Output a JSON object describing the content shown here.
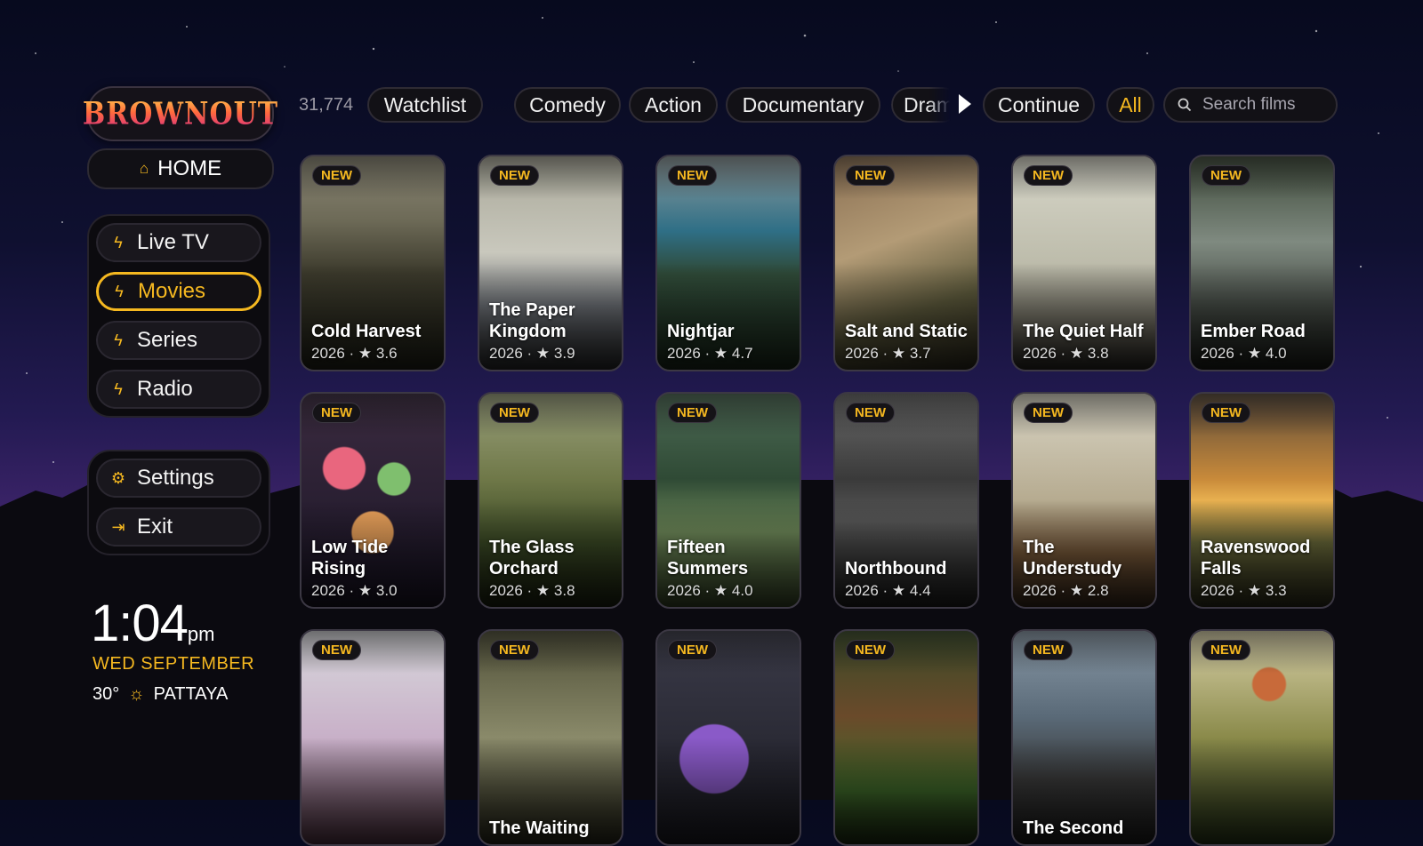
{
  "app": {
    "logo_text": "BROWNOUT"
  },
  "sidebar": {
    "home_label": "HOME",
    "home_icon": "home-icon",
    "nav": [
      {
        "label": "Live TV",
        "icon": "bolt-icon"
      },
      {
        "label": "Movies",
        "icon": "bolt-icon",
        "active": true
      },
      {
        "label": "Series",
        "icon": "bolt-icon"
      },
      {
        "label": "Radio",
        "icon": "bolt-icon"
      }
    ],
    "system": [
      {
        "label": "Settings",
        "icon": "gear-icon"
      },
      {
        "label": "Exit",
        "icon": "exit-icon"
      }
    ]
  },
  "clock": {
    "time": "1:04",
    "ampm": "pm",
    "date": "WED SEPTEMBER",
    "temperature": "30°",
    "city": "PATTAYA",
    "weather_icon": "sun-icon"
  },
  "topbar": {
    "count": "31,774",
    "watchlist": "Watchlist",
    "genres": [
      "Comedy",
      "Action",
      "Documentary",
      "Drama"
    ],
    "continue": "Continue",
    "all": "All",
    "search_placeholder": "Search films"
  },
  "accent_color": "#f5b820",
  "movies": [
    {
      "title": "Cold Harvest",
      "year": "2026",
      "rating": "3.6",
      "badge": "NEW"
    },
    {
      "title": "The Paper Kingdom",
      "year": "2026",
      "rating": "3.9",
      "badge": "NEW"
    },
    {
      "title": "Nightjar",
      "year": "2026",
      "rating": "4.7",
      "badge": "NEW"
    },
    {
      "title": "Salt and Static",
      "year": "2026",
      "rating": "3.7",
      "badge": "NEW"
    },
    {
      "title": "The Quiet Half",
      "year": "2026",
      "rating": "3.8",
      "badge": "NEW"
    },
    {
      "title": "Ember Road",
      "year": "2026",
      "rating": "4.0",
      "badge": "NEW"
    },
    {
      "title": "Low Tide Rising",
      "year": "2026",
      "rating": "3.0",
      "badge": "NEW"
    },
    {
      "title": "The Glass Orchard",
      "year": "2026",
      "rating": "3.8",
      "badge": "NEW"
    },
    {
      "title": "Fifteen Summers",
      "year": "2026",
      "rating": "4.0",
      "badge": "NEW"
    },
    {
      "title": "Northbound",
      "year": "2026",
      "rating": "4.4",
      "badge": "NEW"
    },
    {
      "title": "The Understudy",
      "year": "2026",
      "rating": "2.8",
      "badge": "NEW"
    },
    {
      "title": "Ravenswood Falls",
      "year": "2026",
      "rating": "3.3",
      "badge": "NEW"
    },
    {
      "title": "",
      "year": "",
      "rating": "",
      "badge": "NEW"
    },
    {
      "title": "The Waiting",
      "year": "",
      "rating": "",
      "badge": "NEW"
    },
    {
      "title": "",
      "year": "",
      "rating": "",
      "badge": "NEW"
    },
    {
      "title": "",
      "year": "",
      "rating": "",
      "badge": "NEW"
    },
    {
      "title": "The Second",
      "year": "",
      "rating": "",
      "badge": "NEW"
    },
    {
      "title": "",
      "year": "",
      "rating": "",
      "badge": "NEW"
    }
  ]
}
